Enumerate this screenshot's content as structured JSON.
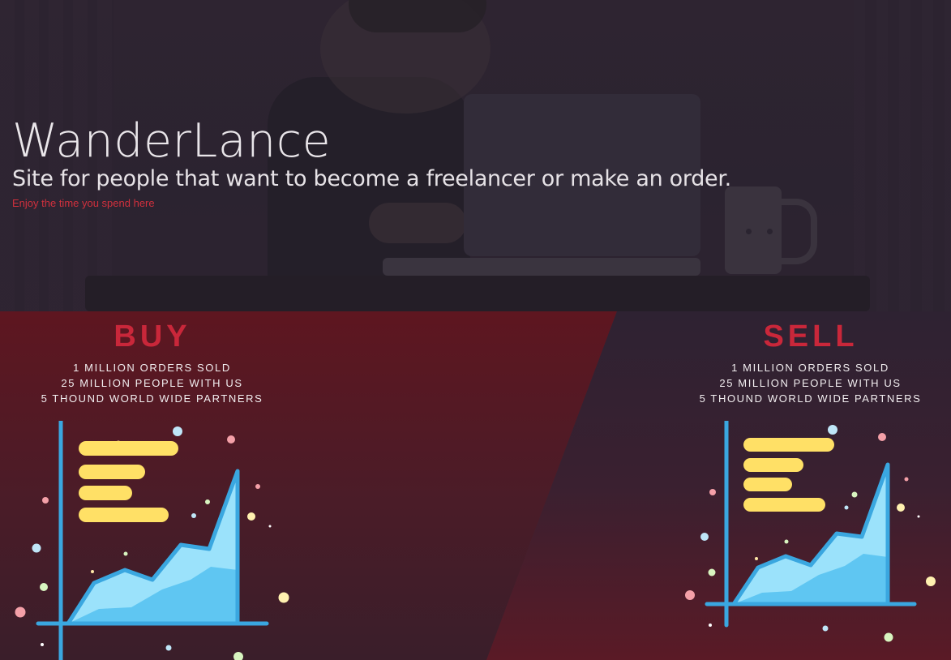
{
  "hero": {
    "title": "WanderLance",
    "subtitle": "Site for people that want to become a freelancer or make an order.",
    "tagline": "Enjoy the time you spend here"
  },
  "buy": {
    "title": "BUY",
    "stats": [
      "1 MILLION ORDERS SOLD",
      "25 MILLION PEOPLE WITH US",
      "5 THOUND WORLD WIDE PARTNERS"
    ]
  },
  "sell": {
    "title": "SELL",
    "stats": [
      "1 MILLION ORDERS SOLD",
      "25 MILLION PEOPLE WITH US",
      "5 THOUND WORLD WIDE PARTNERS"
    ]
  },
  "colors": {
    "accent": "#c9273a",
    "bar": "#ffe066",
    "chart_line": "#3aa7e0",
    "chart_fill": "#9be2fb"
  }
}
